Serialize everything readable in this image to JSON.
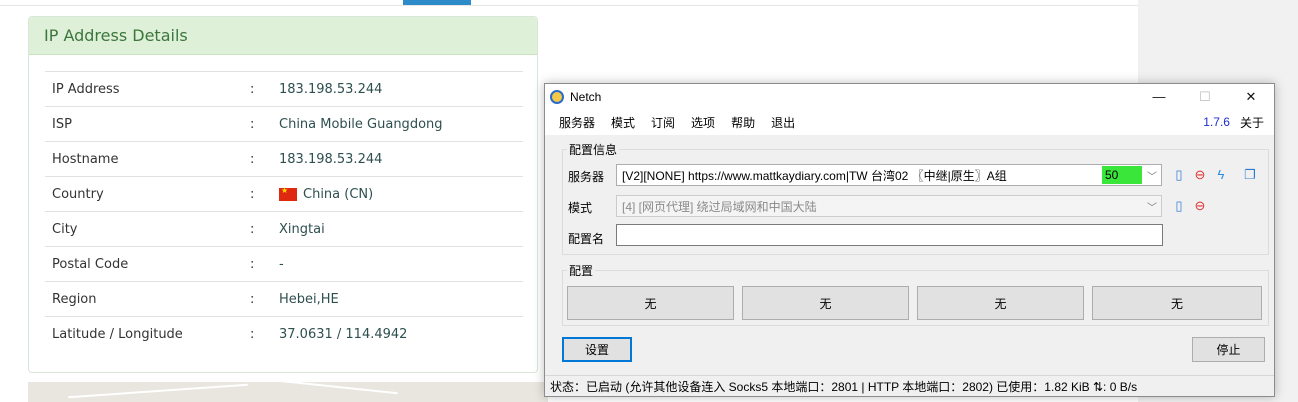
{
  "ip_details": {
    "title": "IP Address Details",
    "rows": [
      {
        "label": "IP Address",
        "sep": ":",
        "value": "183.198.53.244"
      },
      {
        "label": "ISP",
        "sep": ":",
        "value": "China Mobile Guangdong"
      },
      {
        "label": "Hostname",
        "sep": ":",
        "value": "183.198.53.244"
      },
      {
        "label": "Country",
        "sep": ":",
        "value": "China (CN)"
      },
      {
        "label": "City",
        "sep": ":",
        "value": "Xingtai"
      },
      {
        "label": "Postal Code",
        "sep": ":",
        "value": "-"
      },
      {
        "label": "Region",
        "sep": ":",
        "value": "Hebei,HE"
      },
      {
        "label": "Latitude / Longitude",
        "sep": ":",
        "value": "37.0631 / 114.4942"
      }
    ]
  },
  "netch": {
    "title": "Netch",
    "window_controls": {
      "minimize": "—",
      "maximize": "☐",
      "close": "✕"
    },
    "menu": [
      "服务器",
      "模式",
      "订阅",
      "选项",
      "帮助",
      "退出"
    ],
    "version": "1.7.6",
    "about": "关于",
    "config_group": "配置信息",
    "server_label": "服务器",
    "server_value": "[V2][NONE] https://www.mattkaydiary.com|TW 台湾02 〖中继|原生〗A组",
    "server_latency": "50",
    "mode_label": "模式",
    "mode_value": "[4] [网页代理] 绕过局域网和中国大陆",
    "profile_name_label": "配置名",
    "profile_name_value": "",
    "profiles_group": "配置",
    "profile_buttons": [
      "无",
      "无",
      "无",
      "无"
    ],
    "settings_button": "设置",
    "stop_button": "停止",
    "status": "状态：已启动 (允许其他设备连入 Socks5 本地端口：2801 | HTTP 本地端口：2802) 已使用：1.82 KiB ⇅: 0 B/s",
    "colors": {
      "latency_bg": "#39e639",
      "version": "#1e2bd6",
      "focus": "#0078d7"
    }
  }
}
